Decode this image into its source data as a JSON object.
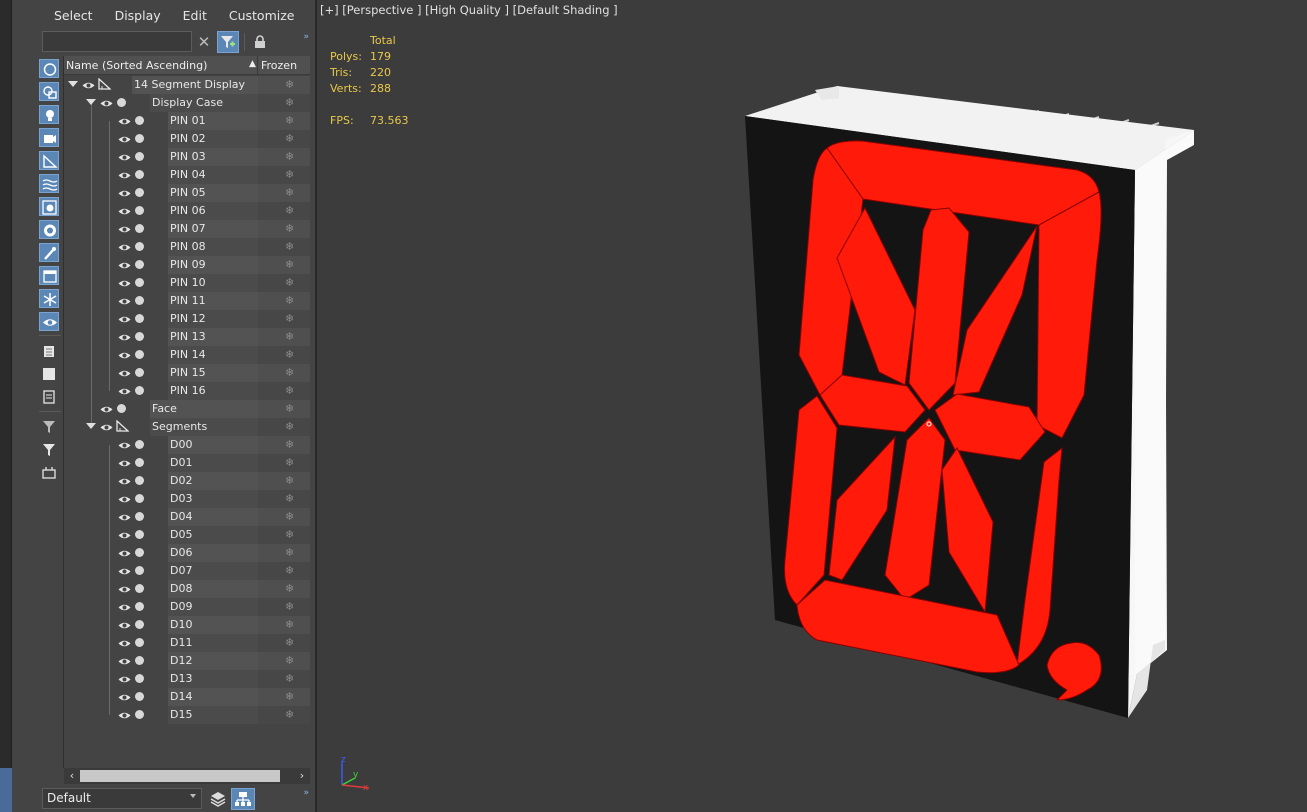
{
  "menu": [
    "Select",
    "Display",
    "Edit",
    "Customize"
  ],
  "search": {
    "value": "",
    "clear_label": "✕"
  },
  "columns": {
    "name": "Name (Sorted Ascending)",
    "sort_indicator": "▲",
    "frozen": "Frozen"
  },
  "tree": {
    "root": "14 Segment Display",
    "display_case": "Display Case",
    "pins": [
      "PIN 01",
      "PIN 02",
      "PIN 03",
      "PIN 04",
      "PIN 05",
      "PIN 06",
      "PIN 07",
      "PIN 08",
      "PIN 09",
      "PIN 10",
      "PIN 11",
      "PIN 12",
      "PIN 13",
      "PIN 14",
      "PIN 15",
      "PIN 16"
    ],
    "face": "Face",
    "segments": "Segments",
    "segment_items": [
      "D00",
      "D01",
      "D02",
      "D03",
      "D04",
      "D05",
      "D06",
      "D07",
      "D08",
      "D09",
      "D10",
      "D11",
      "D12",
      "D13",
      "D14",
      "D15"
    ],
    "frozen_glyph": "❄"
  },
  "layer": {
    "value": "Default"
  },
  "viewport": {
    "label": "[+] [Perspective ] [High Quality ] [Default Shading ]",
    "stats": {
      "header": "Total",
      "polys_label": "Polys:",
      "polys": "179",
      "tris_label": "Tris:",
      "tris": "220",
      "verts_label": "Verts:",
      "verts": "288",
      "fps_label": "FPS:",
      "fps": "73.563"
    },
    "axis": {
      "x": "x",
      "y": "y",
      "z": "z"
    }
  },
  "colors": {
    "segment_red": "#ff1a0a",
    "accent_blue": "#5b87b6",
    "stats_yellow": "#e8c84a"
  },
  "icons": [
    "filter-icon",
    "lock-icon",
    "sphere-icon",
    "shapes-icon",
    "light-icon",
    "camera-icon",
    "helper-icon",
    "spacewarp-icon",
    "group-icon",
    "xref-icon",
    "bone-icon",
    "container-icon",
    "frozen-icon",
    "hidden-icon",
    "list-icon",
    "square-icon",
    "document-icon",
    "funnel-icon",
    "funnel-plain-icon",
    "bag-icon",
    "eye-icon",
    "snowflake-icon",
    "layers-icon",
    "hierarchy-icon"
  ]
}
